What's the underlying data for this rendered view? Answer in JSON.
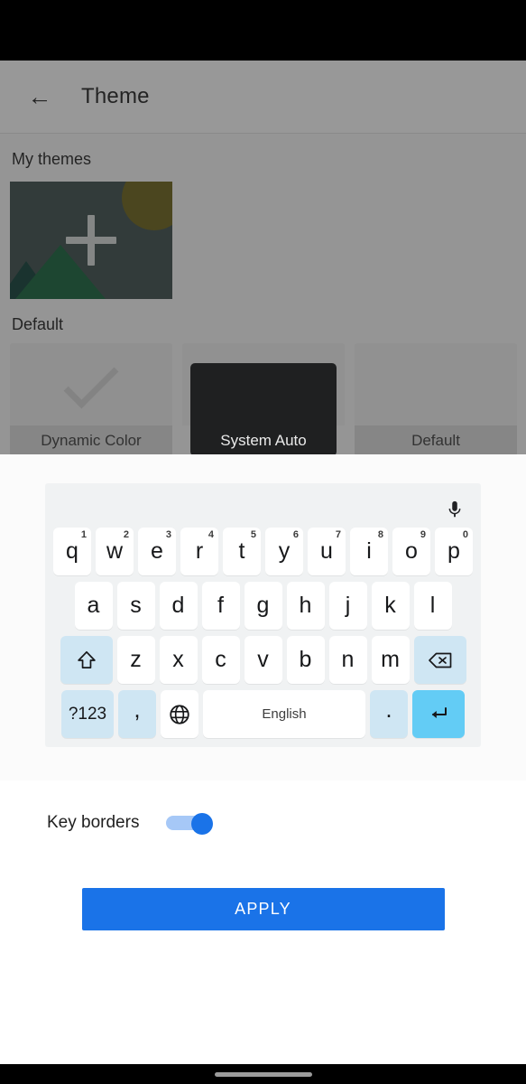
{
  "app": {
    "appbar": {
      "back_icon": "arrow-left-icon",
      "title": "Theme"
    },
    "sections": {
      "my_themes_label": "My themes",
      "default_label": "Default"
    },
    "add_theme": {
      "icon": "plus-icon"
    },
    "theme_cards": [
      {
        "label": "Dynamic Color",
        "selected": true,
        "icon": "check-icon"
      },
      {
        "label": "System Auto",
        "selected": false
      },
      {
        "label": "Default",
        "selected": false
      }
    ]
  },
  "sheet": {
    "keyboard_preview": {
      "mic_icon": "microphone-icon",
      "row1": [
        {
          "key": "q",
          "hint": "1"
        },
        {
          "key": "w",
          "hint": "2"
        },
        {
          "key": "e",
          "hint": "3"
        },
        {
          "key": "r",
          "hint": "4"
        },
        {
          "key": "t",
          "hint": "5"
        },
        {
          "key": "y",
          "hint": "6"
        },
        {
          "key": "u",
          "hint": "7"
        },
        {
          "key": "i",
          "hint": "8"
        },
        {
          "key": "o",
          "hint": "9"
        },
        {
          "key": "p",
          "hint": "0"
        }
      ],
      "row2": [
        "a",
        "s",
        "d",
        "f",
        "g",
        "h",
        "j",
        "k",
        "l"
      ],
      "row3": {
        "shift_icon": "shift-icon",
        "letters": [
          "z",
          "x",
          "c",
          "v",
          "b",
          "n",
          "m"
        ],
        "backspace_icon": "backspace-icon"
      },
      "row4": {
        "symbols_label": "?123",
        "comma": ",",
        "globe_icon": "globe-icon",
        "space_label": "English",
        "period": ".",
        "enter_icon": "enter-icon"
      }
    },
    "key_borders": {
      "label": "Key borders",
      "enabled": true
    },
    "apply_button": {
      "label": "APPLY"
    }
  },
  "colors": {
    "accent_blue": "#1a73e8",
    "enter_key": "#63ccf5",
    "modifier_key": "#cfe6f3",
    "keyboard_bg": "#f0f2f3",
    "toggle_track": "#a6c8f7"
  },
  "navbar": {
    "home_indicator": "home-indicator"
  }
}
